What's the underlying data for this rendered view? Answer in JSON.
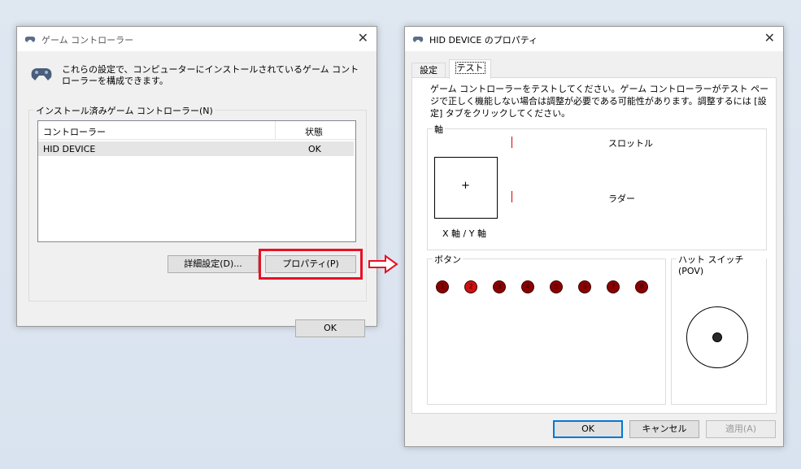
{
  "left_window": {
    "title": "ゲーム コントローラー",
    "description": "これらの設定で、コンピューターにインストールされているゲーム コントローラーを構成できます。",
    "group_label": "インストール済みゲーム コントローラー(N)",
    "columns": {
      "controller": "コントローラー",
      "status": "状態"
    },
    "rows": [
      {
        "name": "HID DEVICE",
        "status": "OK"
      }
    ],
    "advanced_button": "詳細設定(D)...",
    "properties_button": "プロパティ(P)",
    "ok_button": "OK",
    "highlight_color": "#e81123"
  },
  "right_window": {
    "title": "HID DEVICE のプロパティ",
    "tabs": [
      {
        "label": "設定"
      },
      {
        "label": "テスト",
        "active": true
      }
    ],
    "instructions": "ゲーム コントローラーをテストしてください。ゲーム コントローラーがテスト ページで正しく機能しない場合は調整が必要である可能性があります。調整するには [設定] タブをクリックしてください。",
    "axes_group": "軸",
    "xy_label": "X 軸 / Y 軸",
    "throttle_label": "スロットル",
    "rudder_label": "ラダー",
    "buttons_group": "ボタン",
    "button_numbers": [
      "1",
      "2",
      "3",
      "4",
      "5",
      "6",
      "7",
      "8"
    ],
    "pressed_button": "2",
    "pov_group": "ハット スイッチ (POV)",
    "ok_button": "OK",
    "cancel_button": "キャンセル",
    "apply_button": "適用(A)"
  }
}
